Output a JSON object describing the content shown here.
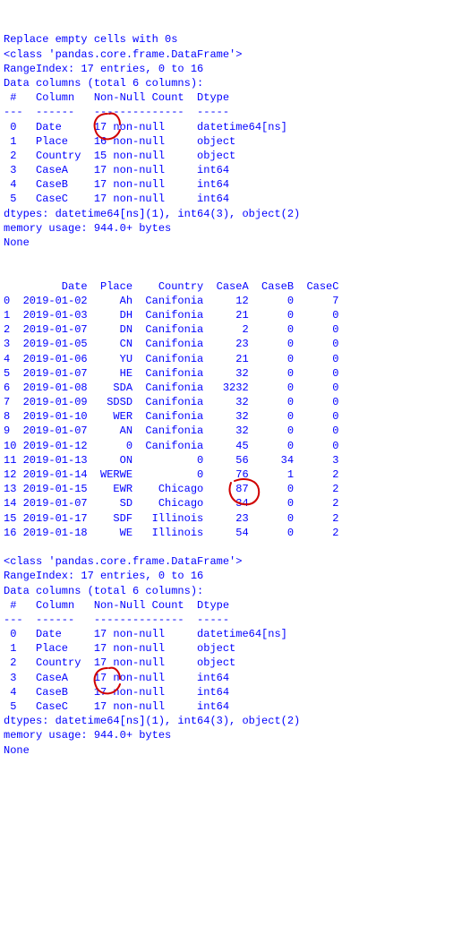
{
  "title": "Replace empty cells with 0s",
  "info1": {
    "class_line": "<class 'pandas.core.frame.DataFrame'>",
    "range_line": "RangeIndex: 17 entries, 0 to 16",
    "cols_line": "Data columns (total 6 columns):",
    "header_line": " #   Column   Non-Null Count  Dtype         ",
    "divider_line": "---  ------   --------------  -----         ",
    "rows": [
      " 0   Date     17 non-null     datetime64[ns]",
      " 1   Place    16 non-null     object        ",
      " 2   Country  15 non-null     object        ",
      " 3   CaseA    17 non-null     int64         ",
      " 4   CaseB    17 non-null     int64         ",
      " 5   CaseC    17 non-null     int64         "
    ],
    "dtypes_line": "dtypes: datetime64[ns](1), int64(3), object(2)",
    "memory_line": "memory usage: 944.0+ bytes",
    "none_line": "None"
  },
  "df": {
    "header": "         Date  Place    Country  CaseA  CaseB  CaseC",
    "rows": [
      "0  2019-01-02     Ah  Canifonia     12      0      7",
      "1  2019-01-03     DH  Canifonia     21      0      0",
      "2  2019-01-07     DN  Canifonia      2      0      0",
      "3  2019-01-05     CN  Canifonia     23      0      0",
      "4  2019-01-06     YU  Canifonia     21      0      0",
      "5  2019-01-07     HE  Canifonia     32      0      0",
      "6  2019-01-08    SDA  Canifonia   3232      0      0",
      "7  2019-01-09   SDSD  Canifonia     32      0      0",
      "8  2019-01-10    WER  Canifonia     32      0      0",
      "9  2019-01-07     AN  Canifonia     32      0      0",
      "10 2019-01-12      0  Canifonia     45      0      0",
      "11 2019-01-13     ON          0     56     34      3",
      "12 2019-01-14  WERWE          0     76      1      2",
      "13 2019-01-15    EWR    Chicago     87      0      2",
      "14 2019-01-07     SD    Chicago     34      0      2",
      "15 2019-01-17    SDF   Illinois     23      0      2",
      "16 2019-01-18     WE   Illinois     54      0      2"
    ]
  },
  "info2": {
    "class_line": "<class 'pandas.core.frame.DataFrame'>",
    "range_line": "RangeIndex: 17 entries, 0 to 16",
    "cols_line": "Data columns (total 6 columns):",
    "header_line": " #   Column   Non-Null Count  Dtype         ",
    "divider_line": "---  ------   --------------  -----         ",
    "rows": [
      " 0   Date     17 non-null     datetime64[ns]",
      " 1   Place    17 non-null     object        ",
      " 2   Country  17 non-null     object        ",
      " 3   CaseA    17 non-null     int64         ",
      " 4   CaseB    17 non-null     int64         ",
      " 5   CaseC    17 non-null     int64         "
    ],
    "dtypes_line": "dtypes: datetime64[ns](1), int64(3), object(2)",
    "memory_line": "memory usage: 944.0+ bytes",
    "none_line": "None"
  }
}
